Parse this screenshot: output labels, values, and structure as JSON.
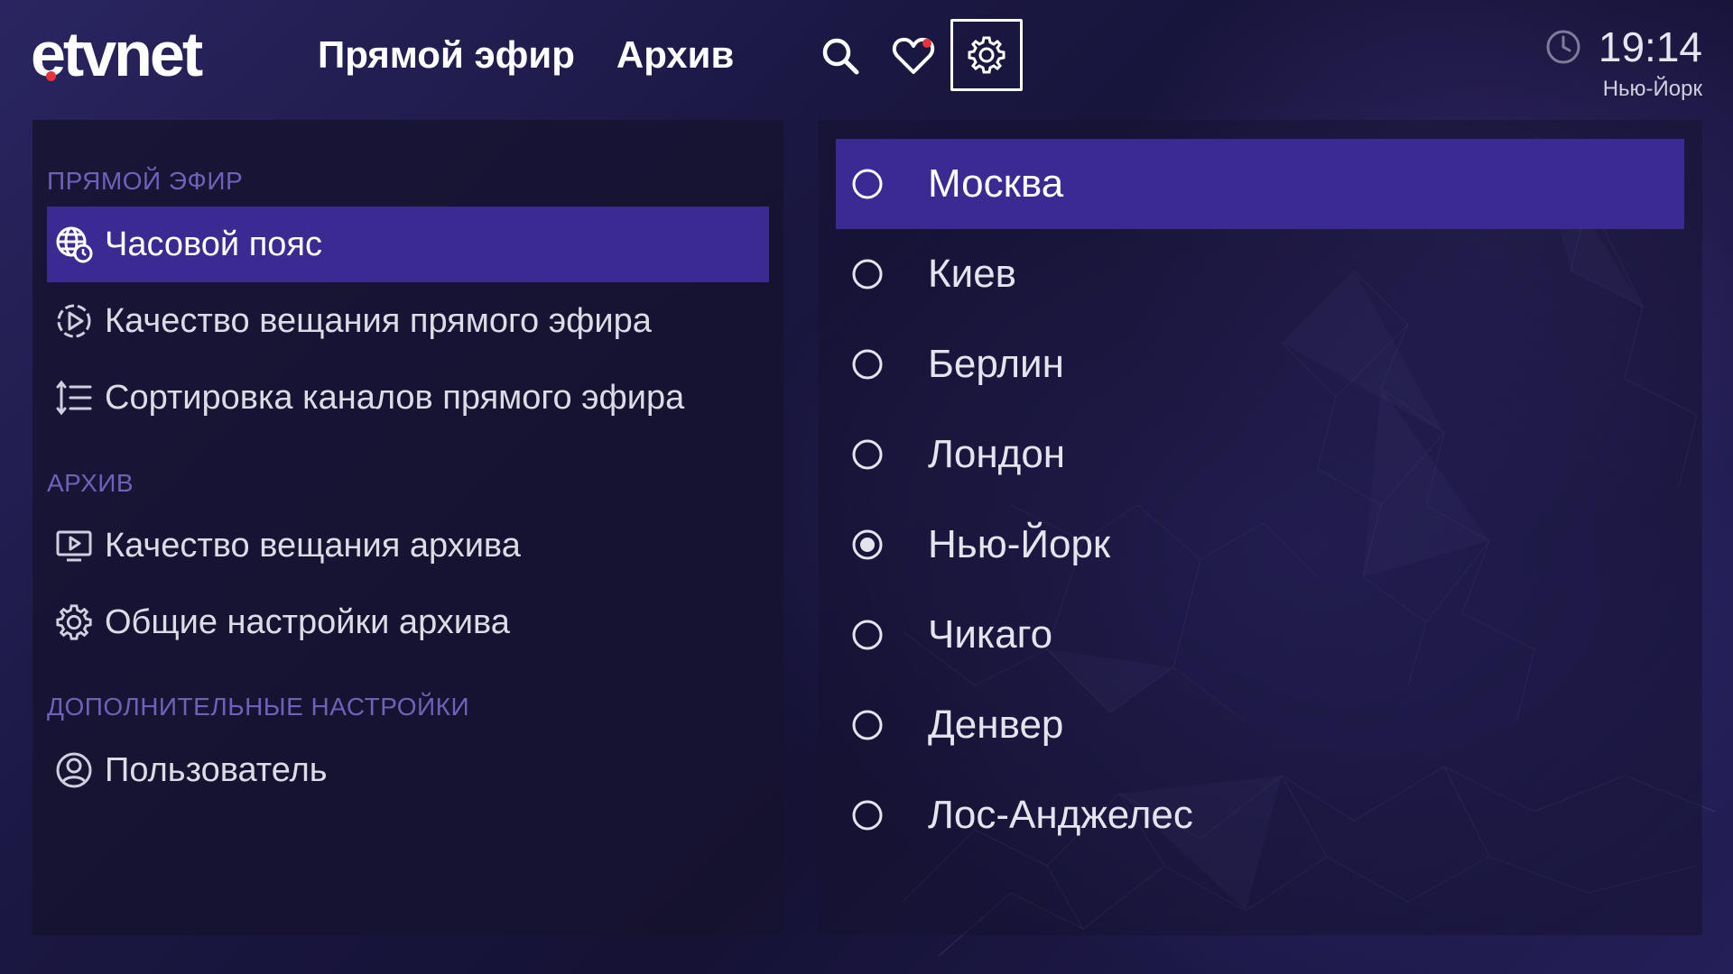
{
  "header": {
    "logo_text": "etvnet",
    "nav": [
      {
        "label": "Прямой эфир"
      },
      {
        "label": "Архив"
      }
    ],
    "icons": [
      "search-icon",
      "heart-icon",
      "gear-icon"
    ],
    "time": "19:14",
    "city": "Нью-Йорк"
  },
  "sidebar": {
    "sections": [
      {
        "title": "ПРЯМОЙ ЭФИР"
      },
      {
        "title": "АРХИВ"
      },
      {
        "title": "ДОПОЛНИТЕЛЬНЫЕ НАСТРОЙКИ"
      }
    ],
    "items": [
      {
        "label": "Часовой пояс",
        "icon": "globe-clock-icon",
        "active": true
      },
      {
        "label": "Качество вещания прямого эфира",
        "icon": "play-circle-icon"
      },
      {
        "label": "Сортировка каналов прямого эфира",
        "icon": "sort-list-icon"
      },
      {
        "label": "Качество вещания архива",
        "icon": "tv-play-icon"
      },
      {
        "label": "Общие настройки архива",
        "icon": "gear-icon"
      },
      {
        "label": "Пользователь",
        "icon": "user-icon"
      }
    ]
  },
  "timezones": {
    "selected": "Нью-Йорк",
    "focused": "Москва",
    "options": [
      {
        "label": "Москва"
      },
      {
        "label": "Киев"
      },
      {
        "label": "Берлин"
      },
      {
        "label": "Лондон"
      },
      {
        "label": "Нью-Йорк"
      },
      {
        "label": "Чикаго"
      },
      {
        "label": "Денвер"
      },
      {
        "label": "Лос-Анджелес"
      }
    ]
  },
  "colors": {
    "accent": "#3a2a92",
    "logo_dot": "#e8323c",
    "section_title": "#6c63b8"
  }
}
